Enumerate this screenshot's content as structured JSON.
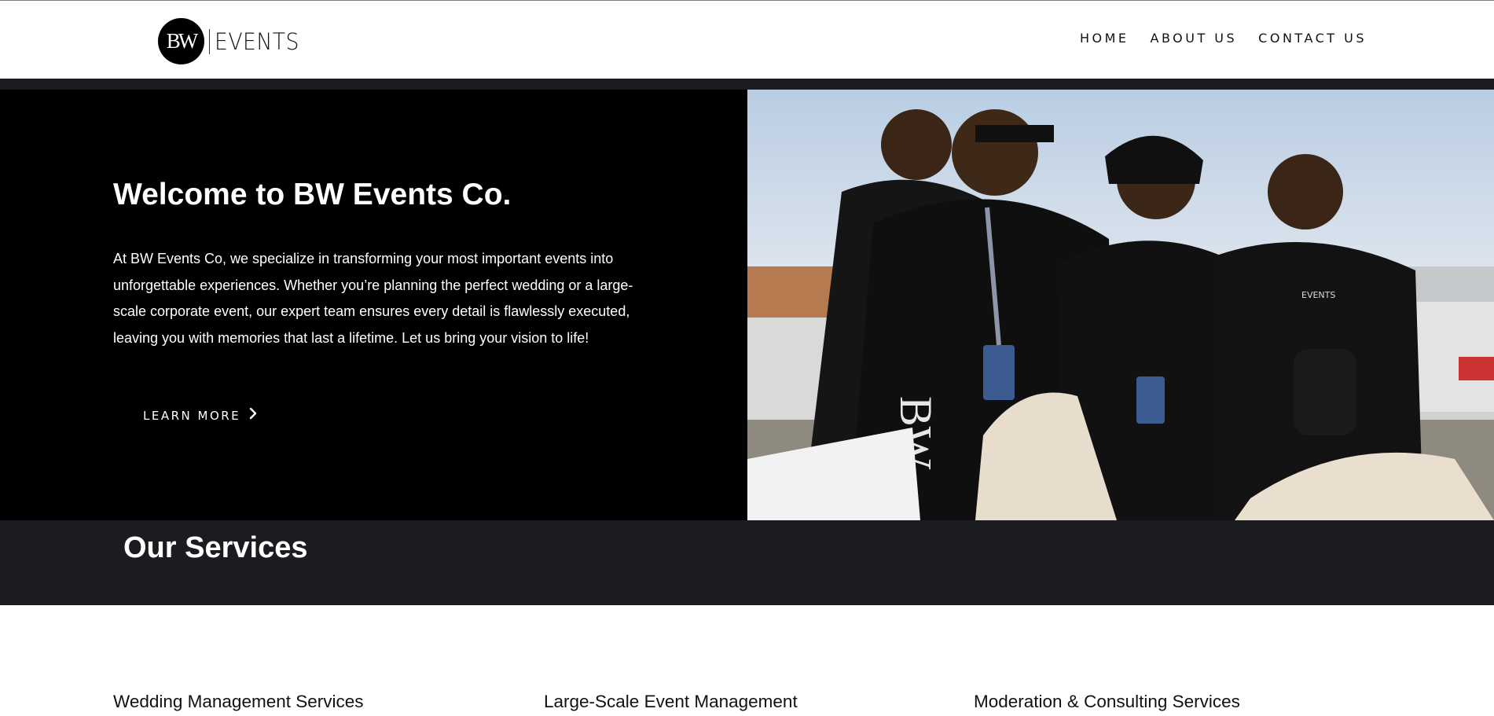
{
  "header": {
    "logo_mark": "BW",
    "logo_text": "EVENTS",
    "nav": [
      {
        "label": "HOME"
      },
      {
        "label": "ABOUT US"
      },
      {
        "label": "CONTACT US"
      }
    ]
  },
  "hero": {
    "title": "Welcome to BW Events Co.",
    "lines": [
      "At BW Events Co, we specialize in transforming your most important events into",
      "unforgettable experiences. Whether you’re planning the perfect wedding or a large-",
      "scale corporate event, our expert team ensures every detail is flawlessly executed,",
      "leaving you with memories that last a lifetime. Let us bring your vision to life!"
    ],
    "cta_label": "LEARN MORE",
    "cta_icon": "chevron-right-icon",
    "image_caption_marks": [
      "BW",
      "EVENTS"
    ]
  },
  "services": {
    "title": "Our Services",
    "items": [
      {
        "label": "Wedding Management Services"
      },
      {
        "label": "Large-Scale Event Management"
      },
      {
        "label": "Moderation & Consulting Services"
      }
    ]
  },
  "colors": {
    "dark_band": "#1b1c1f",
    "hero_bg": "#000000",
    "text_light": "#ffffff",
    "text_dark": "#111111"
  }
}
